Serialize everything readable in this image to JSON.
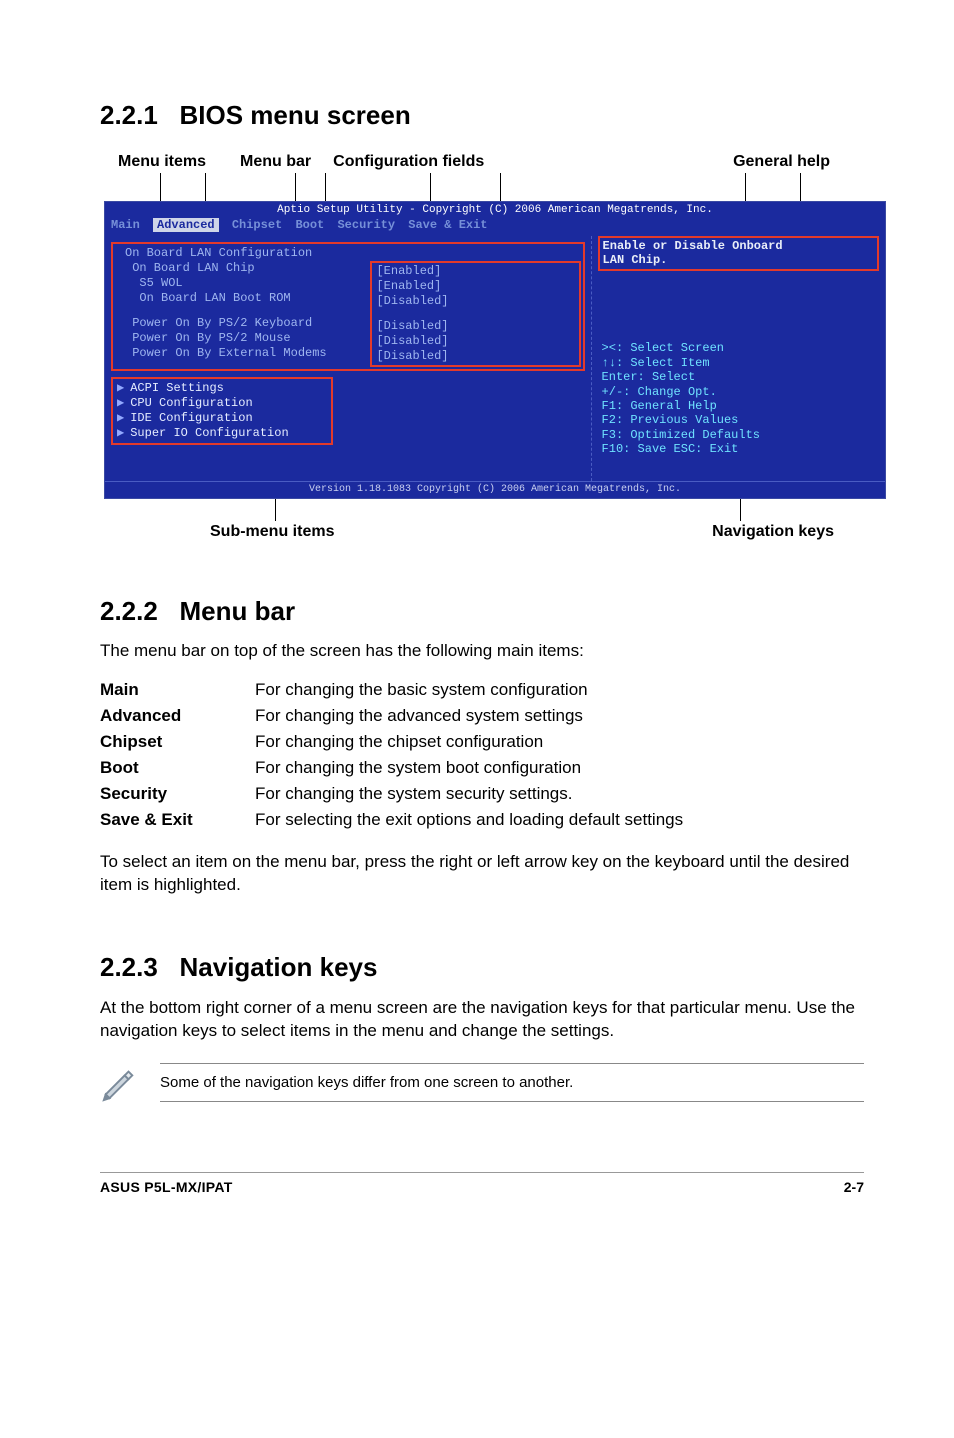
{
  "sections": {
    "s1": {
      "num": "2.2.1",
      "title": "BIOS menu screen"
    },
    "s2": {
      "num": "2.2.2",
      "title": "Menu bar"
    },
    "s3": {
      "num": "2.2.3",
      "title": "Navigation keys"
    }
  },
  "diagram_top_labels": {
    "menu_items": "Menu items",
    "menu_bar": "Menu bar",
    "config_fields": "Configuration fields",
    "general_help": "General help"
  },
  "diagram_bottom_labels": {
    "submenu": "Sub-menu items",
    "navkeys": "Navigation keys"
  },
  "bios": {
    "title": "Aptio Setup Utility - Copyright (C) 2006 American Megatrends, Inc.",
    "menubar": {
      "main": "Main",
      "advanced": "Advanced",
      "chipset": "Chipset",
      "boot": "Boot",
      "security": "Security",
      "save": "Save & Exit"
    },
    "items": {
      "r0": {
        "label": "On Board LAN Configuration",
        "value": ""
      },
      "r1": {
        "label": " On Board LAN Chip",
        "value": "[Enabled]"
      },
      "r2": {
        "label": "  S5 WOL",
        "value": "[Enabled]"
      },
      "r3": {
        "label": "  On Board LAN Boot ROM",
        "value": "[Disabled]"
      },
      "r4": {
        "label": " Power On By PS/2 Keyboard",
        "value": "[Disabled]"
      },
      "r5": {
        "label": " Power On By PS/2 Mouse",
        "value": "[Disabled]"
      },
      "r6": {
        "label": " Power On By External Modems",
        "value": "[Disabled]"
      }
    },
    "submenus": {
      "i0": "ACPI Settings",
      "i1": "CPU Configuration",
      "i2": "IDE Configuration",
      "i3": "Super IO Configuration"
    },
    "help_text_l1": "Enable or Disable Onboard",
    "help_text_l2": "LAN Chip.",
    "nav": {
      "l0": "><: Select Screen",
      "l1": "↑↓: Select Item",
      "l2": "Enter: Select",
      "l3": "+/-: Change Opt.",
      "l4": "F1: General Help",
      "l5": "F2: Previous Values",
      "l6": "F3: Optimized Defaults",
      "l7": "F10: Save   ESC: Exit"
    },
    "footer": "Version 1.18.1083 Copyright (C) 2006 American Megatrends, Inc."
  },
  "menubar_intro": "The menu bar on top of the screen has the following main items:",
  "defs": {
    "r0": {
      "k": "Main",
      "v": "For changing the basic system configuration"
    },
    "r1": {
      "k": "Advanced",
      "v": "For changing the advanced system settings"
    },
    "r2": {
      "k": "Chipset",
      "v": "For changing the chipset configuration"
    },
    "r3": {
      "k": "Boot",
      "v": "For changing the system boot configuration"
    },
    "r4": {
      "k": "Security",
      "v": "For changing the system security settings."
    },
    "r5": {
      "k": "Save & Exit",
      "v": "For selecting the exit options and loading default settings"
    }
  },
  "menubar_outro": "To select an item on the menu bar, press the right or left arrow key on the keyboard until the desired item is highlighted.",
  "navkeys_text": "At the bottom right corner of a menu screen are the navigation keys for that particular menu. Use the navigation keys to select items in the menu and change the settings.",
  "note_text": "Some of the navigation keys differ from one screen to another.",
  "page_footer": {
    "left": "ASUS P5L-MX/IPAT",
    "right": "2-7"
  }
}
